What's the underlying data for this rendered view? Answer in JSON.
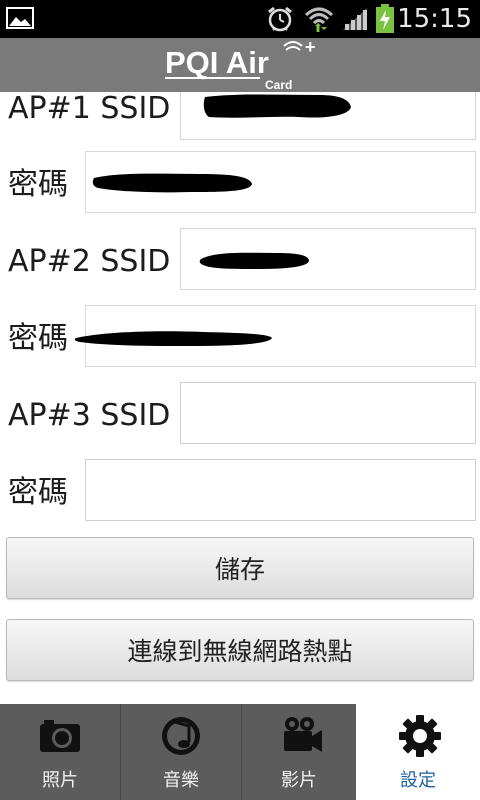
{
  "status_bar": {
    "time": "15:15",
    "icons": [
      "gallery-icon",
      "alarm-icon",
      "wifi-icon",
      "signal-icon",
      "battery-charging-icon"
    ]
  },
  "header": {
    "logo_main": "PQI Air",
    "logo_sub": "Card",
    "logo_plus": "+"
  },
  "form": {
    "ap1_label": "AP#1 SSID",
    "ap1_password_label": "密碼",
    "ap2_label": "AP#2 SSID",
    "ap2_password_label": "密碼",
    "ap3_label": "AP#3 SSID",
    "ap3_password_label": "密碼",
    "ap3_ssid_value": "",
    "ap3_password_value": ""
  },
  "buttons": {
    "save": "儲存",
    "connect_hotspot": "連線到無線網路熱點"
  },
  "tabs": [
    {
      "label": "照片",
      "icon": "camera-icon",
      "active": false
    },
    {
      "label": "音樂",
      "icon": "music-icon",
      "active": false
    },
    {
      "label": "影片",
      "icon": "video-camera-icon",
      "active": false
    },
    {
      "label": "設定",
      "icon": "gear-icon",
      "active": true
    }
  ],
  "colors": {
    "header_bg": "#7a7a7a",
    "tab_bg": "#5c5c5c",
    "active_tab_label": "#1f5fa0",
    "status_bar_bg": "#000000"
  }
}
